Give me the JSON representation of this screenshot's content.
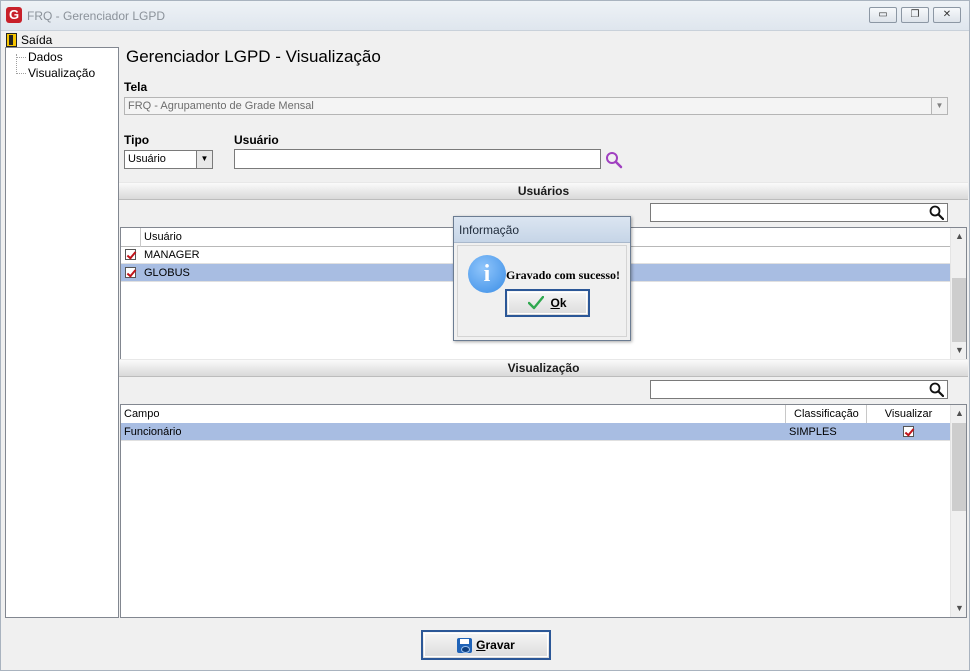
{
  "window": {
    "title": "FRQ - Gerenciador LGPD",
    "logo_letter": "G",
    "controls": {
      "minimize": "▭",
      "restore": "❐",
      "close": "✕"
    }
  },
  "menu": {
    "exit_label": "Saída"
  },
  "tree": {
    "items": [
      {
        "label": "Dados"
      },
      {
        "label": "Visualização"
      }
    ]
  },
  "page": {
    "title": "Gerenciador LGPD - Visualização"
  },
  "form": {
    "tela_label": "Tela",
    "tela_value": "FRQ - Agrupamento de Grade Mensal",
    "tipo_label": "Tipo",
    "tipo_value": "Usuário",
    "usuario_label": "Usuário",
    "usuario_value": ""
  },
  "usuarios": {
    "section_title": "Usuários",
    "search_value": "",
    "column_header": "Usuário",
    "rows": [
      {
        "name": "MANAGER",
        "checked": true,
        "selected": false
      },
      {
        "name": "GLOBUS",
        "checked": true,
        "selected": true
      }
    ]
  },
  "visualizacao": {
    "section_title": "Visualização",
    "search_value": "",
    "columns": [
      "Campo",
      "Classificação",
      "Visualizar"
    ],
    "rows": [
      {
        "campo": "Funcionário",
        "classificacao": "SIMPLES",
        "visualizar": true,
        "selected": true
      }
    ]
  },
  "footer": {
    "save_label": "Gravar"
  },
  "dialog": {
    "title": "Informação",
    "message": "Gravado com sucesso!",
    "ok_label": "Ok",
    "icon_glyph": "i"
  },
  "colors": {
    "selected_row": "#a8bde2",
    "check_mark": "#c0141b",
    "search_icon_accent": "#a040c0",
    "info_icon": "#3a8de6",
    "ok_check": "#2fa84f"
  }
}
